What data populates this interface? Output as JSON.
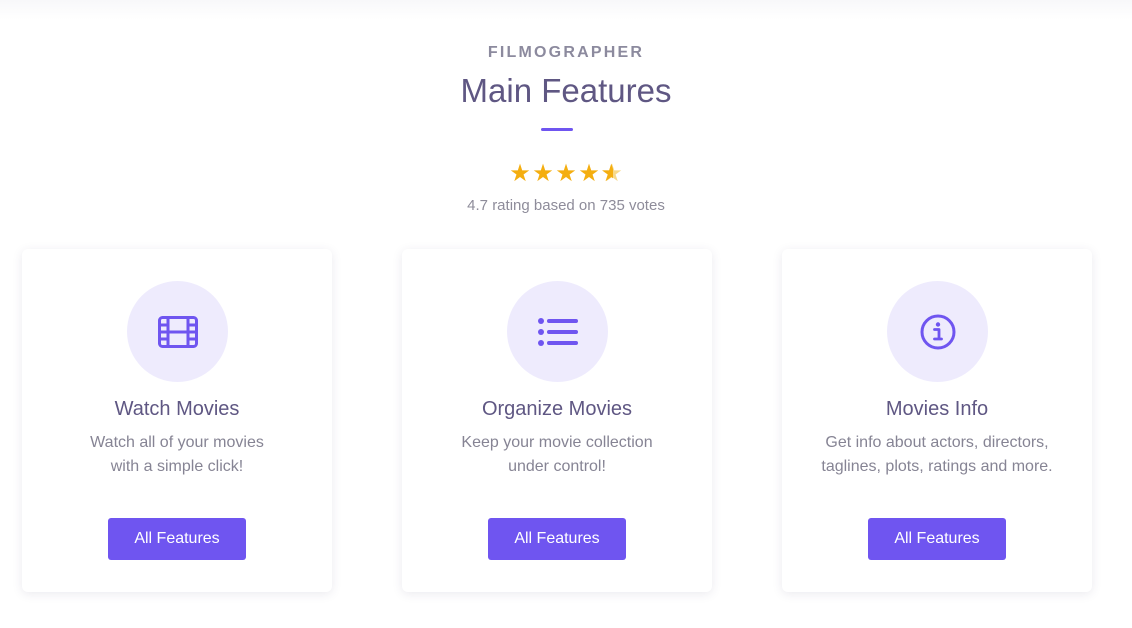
{
  "header": {
    "eyebrow": "FILMOGRAPHER",
    "title": "Main Features"
  },
  "rating": {
    "stars": 4.5,
    "max_stars": 5,
    "text": "4.7 rating based on 735 votes"
  },
  "colors": {
    "accent": "#6f55f0",
    "title": "#5f5783",
    "star": "#f4ae10",
    "icon_bg": "#eeebfd"
  },
  "cards": [
    {
      "icon": "film-icon",
      "title": "Watch Movies",
      "desc_line1": "Watch all of your movies",
      "desc_line2": "with a simple click!",
      "button_label": "All Features"
    },
    {
      "icon": "list-icon",
      "title": "Organize Movies",
      "desc_line1": "Keep your movie collection",
      "desc_line2": "under control!",
      "button_label": "All Features"
    },
    {
      "icon": "info-icon",
      "title": "Movies Info",
      "desc_line1": "Get info about actors, directors,",
      "desc_line2": "taglines, plots, ratings and more.",
      "button_label": "All Features"
    }
  ]
}
